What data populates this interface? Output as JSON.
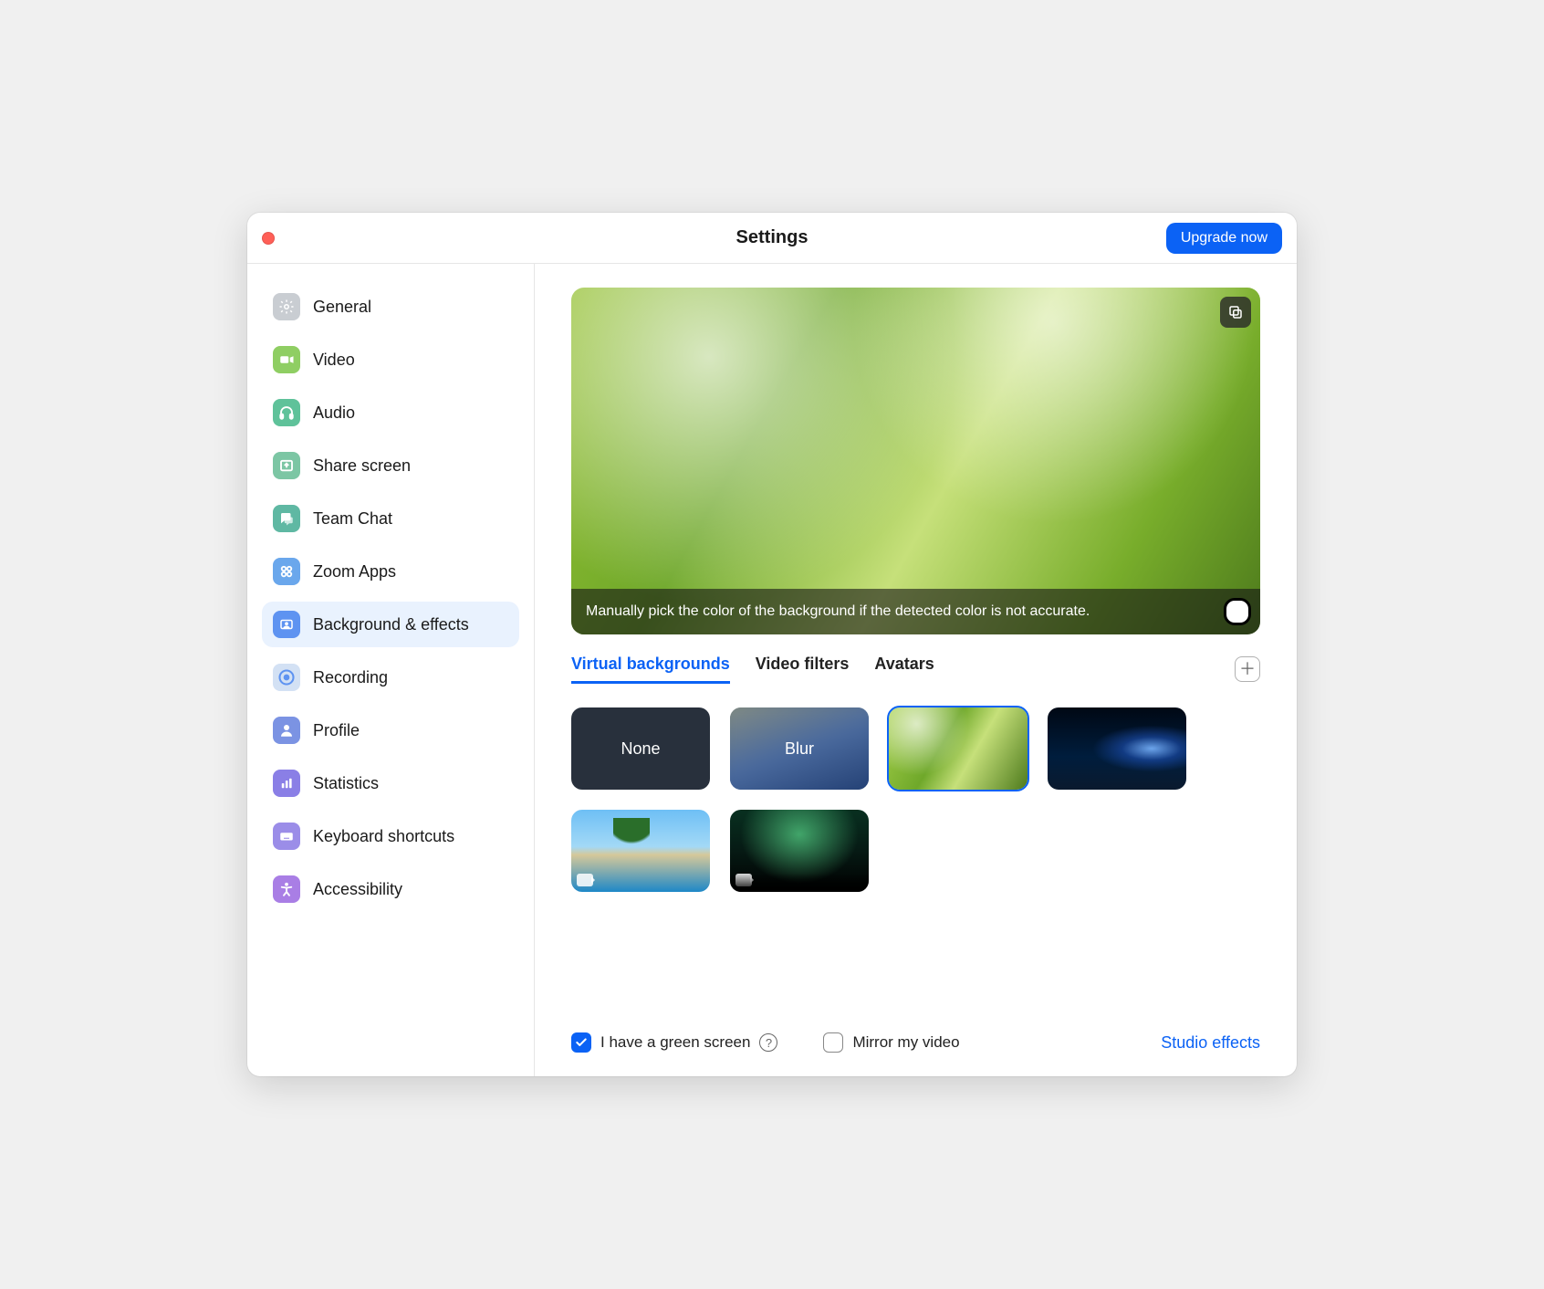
{
  "window": {
    "title": "Settings",
    "upgrade_label": "Upgrade now"
  },
  "sidebar": {
    "items": [
      {
        "label": "General",
        "icon": "gear-icon",
        "bg": "#c9cdd2"
      },
      {
        "label": "Video",
        "icon": "video-icon",
        "bg": "#8fce63"
      },
      {
        "label": "Audio",
        "icon": "headphones-icon",
        "bg": "#5fc29a"
      },
      {
        "label": "Share screen",
        "icon": "share-icon",
        "bg": "#7cc6a4"
      },
      {
        "label": "Team Chat",
        "icon": "chat-icon",
        "bg": "#5fb8a3"
      },
      {
        "label": "Zoom Apps",
        "icon": "apps-icon",
        "bg": "#6aa7ec"
      },
      {
        "label": "Background & effects",
        "icon": "background-icon",
        "bg": "#5e93f1",
        "active": true
      },
      {
        "label": "Recording",
        "icon": "record-icon",
        "bg": "#d3e1f4"
      },
      {
        "label": "Profile",
        "icon": "profile-icon",
        "bg": "#7b93e3"
      },
      {
        "label": "Statistics",
        "icon": "stats-icon",
        "bg": "#8a7fe6"
      },
      {
        "label": "Keyboard shortcuts",
        "icon": "keyboard-icon",
        "bg": "#9b8de8"
      },
      {
        "label": "Accessibility",
        "icon": "accessibility-icon",
        "bg": "#a97ee5"
      }
    ]
  },
  "preview": {
    "tooltip": "Manually pick the color of the background if the detected color is not accurate."
  },
  "tabs": [
    {
      "label": "Virtual backgrounds",
      "active": true
    },
    {
      "label": "Video filters"
    },
    {
      "label": "Avatars"
    }
  ],
  "backgrounds": [
    {
      "label": "None",
      "kind": "none"
    },
    {
      "label": "Blur",
      "kind": "blur"
    },
    {
      "label": "",
      "kind": "grass",
      "selected": true
    },
    {
      "label": "",
      "kind": "earth"
    },
    {
      "label": "",
      "kind": "beach",
      "is_video": true
    },
    {
      "label": "",
      "kind": "aurora",
      "is_video": true
    }
  ],
  "footer": {
    "green_screen_label": "I have a green screen",
    "green_screen_checked": true,
    "mirror_label": "Mirror my video",
    "mirror_checked": false,
    "studio_label": "Studio effects"
  }
}
